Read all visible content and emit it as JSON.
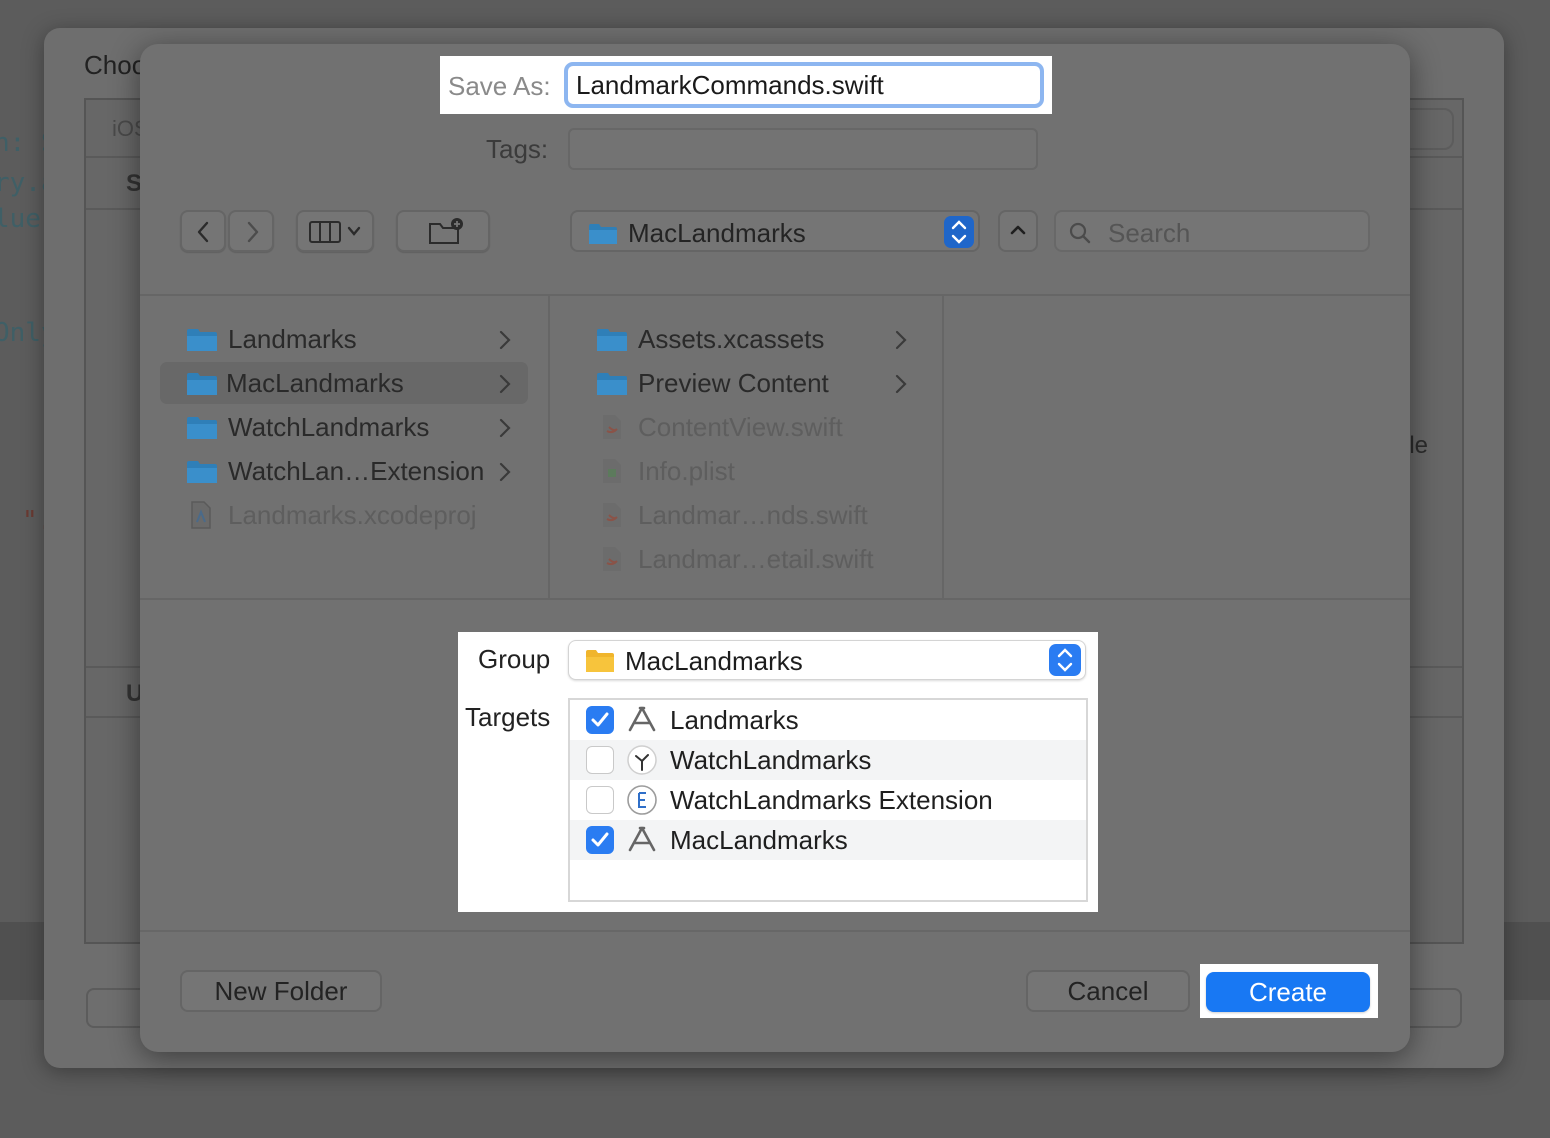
{
  "background": {
    "code_fragments": [
      "n: S",
      "ry.a",
      "lue",
      "Only",
      "\"."
    ],
    "chooser_title": "Choo",
    "chooser_tab": "iOS",
    "chooser_section1": "S",
    "chooser_section2": "U",
    "chooser_trailing": "le"
  },
  "save": {
    "label": "Save As:",
    "value": "LandmarkCommands.swift",
    "tags_label": "Tags:",
    "tags_value": ""
  },
  "toolbar": {
    "location": "MacLandmarks",
    "search_placeholder": "Search"
  },
  "browser": {
    "column1": [
      {
        "name": "Landmarks",
        "kind": "folder",
        "selected": false,
        "enabled": true
      },
      {
        "name": "MacLandmarks",
        "kind": "folder",
        "selected": true,
        "enabled": true
      },
      {
        "name": "WatchLandmarks",
        "kind": "folder",
        "selected": false,
        "enabled": true
      },
      {
        "name": "WatchLan…Extension",
        "kind": "folder",
        "selected": false,
        "enabled": true
      },
      {
        "name": "Landmarks.xcodeproj",
        "kind": "xcodeproj",
        "selected": false,
        "enabled": false
      }
    ],
    "column2": [
      {
        "name": "Assets.xcassets",
        "kind": "folder",
        "enabled": true
      },
      {
        "name": "Preview Content",
        "kind": "folder",
        "enabled": true
      },
      {
        "name": "ContentView.swift",
        "kind": "swift",
        "enabled": false
      },
      {
        "name": "Info.plist",
        "kind": "plist",
        "enabled": false
      },
      {
        "name": "Landmar…nds.swift",
        "kind": "swift",
        "enabled": false
      },
      {
        "name": "Landmar…etail.swift",
        "kind": "swift",
        "enabled": false
      }
    ]
  },
  "group": {
    "label": "Group",
    "value": "MacLandmarks"
  },
  "targets": {
    "label": "Targets",
    "items": [
      {
        "name": "Landmarks",
        "checked": true,
        "icon": "app-store-icon"
      },
      {
        "name": "WatchLandmarks",
        "checked": false,
        "icon": "watch-app-icon"
      },
      {
        "name": "WatchLandmarks Extension",
        "checked": false,
        "icon": "extension-icon"
      },
      {
        "name": "MacLandmarks",
        "checked": true,
        "icon": "app-store-icon"
      }
    ]
  },
  "buttons": {
    "new_folder": "New Folder",
    "cancel": "Cancel",
    "create": "Create"
  },
  "colors": {
    "accent": "#1878f3",
    "checkbox_on": "#2a7cf2",
    "folder_blue": "#2f7fb8",
    "folder_yellow": "#f7c43c",
    "focus_ring": "#8db6f0"
  }
}
